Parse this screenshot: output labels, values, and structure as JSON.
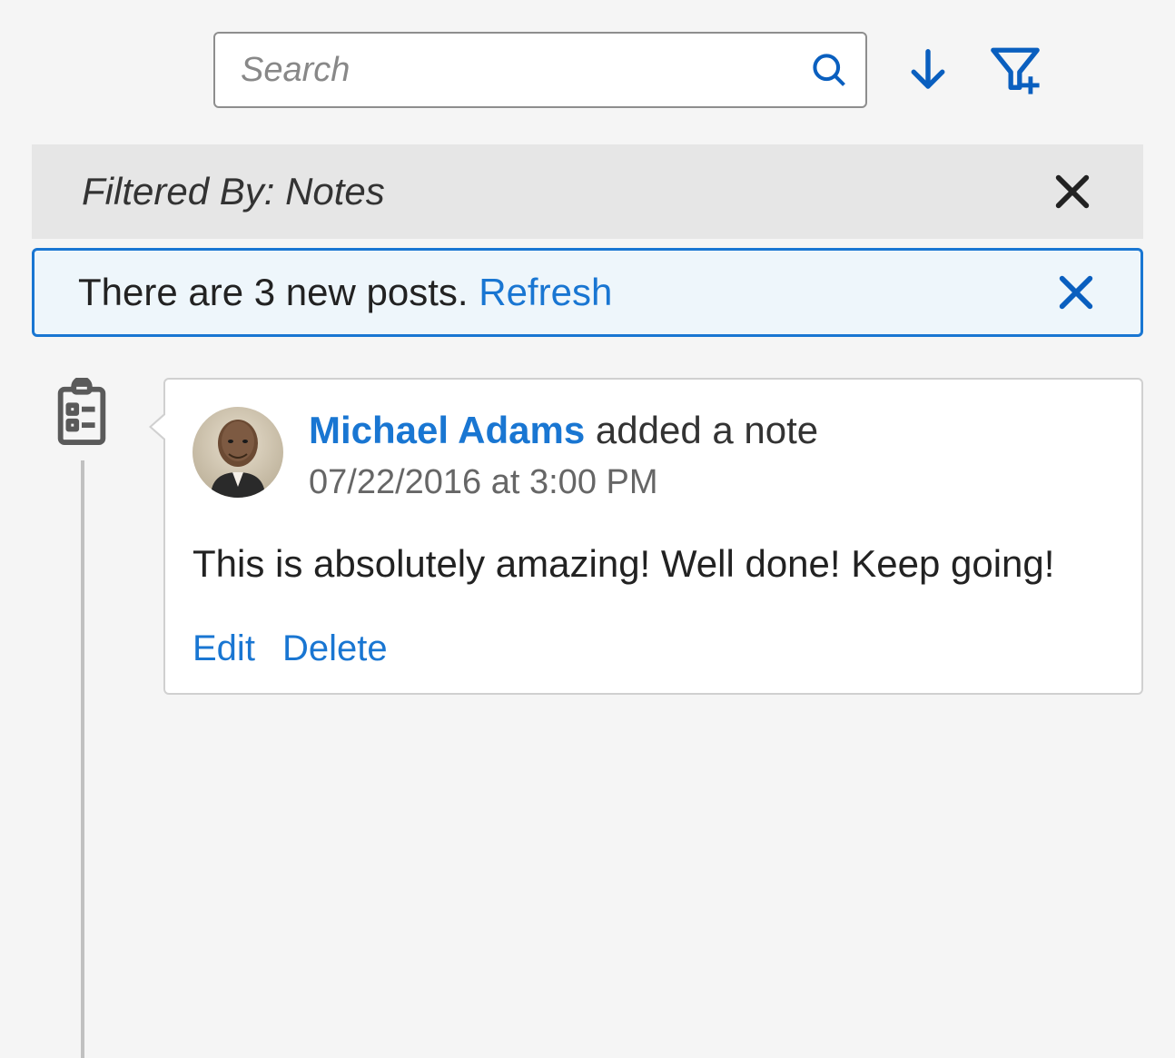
{
  "search": {
    "placeholder": "Search"
  },
  "filter": {
    "label": "Filtered By: Notes"
  },
  "notice": {
    "text": "There are 3 new posts. ",
    "refresh": "Refresh"
  },
  "post": {
    "author": "Michael Adams",
    "action_suffix": " added a note",
    "timestamp": "07/22/2016 at 3:00 PM",
    "body": "This is absolutely amazing! Well done! Keep going!",
    "edit_label": "Edit",
    "delete_label": "Delete"
  }
}
